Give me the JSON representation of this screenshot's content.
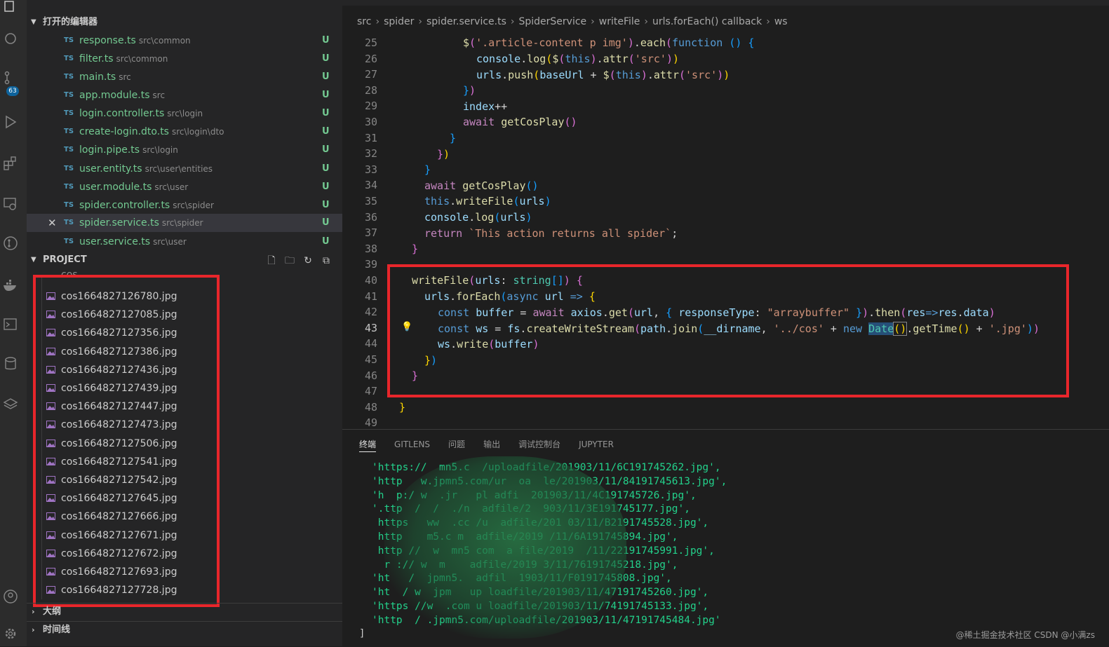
{
  "activity_bar": {
    "badge": "63"
  },
  "sidebar": {
    "open_editors_title": "打开的编辑器",
    "open_editors": [
      {
        "name": "response.ts",
        "dir": "src\\common",
        "status": "U"
      },
      {
        "name": "filter.ts",
        "dir": "src\\common",
        "status": "U"
      },
      {
        "name": "main.ts",
        "dir": "src",
        "status": "U"
      },
      {
        "name": "app.module.ts",
        "dir": "src",
        "status": "U"
      },
      {
        "name": "login.controller.ts",
        "dir": "src\\login",
        "status": "U"
      },
      {
        "name": "create-login.dto.ts",
        "dir": "src\\login\\dto",
        "status": "U"
      },
      {
        "name": "login.pipe.ts",
        "dir": "src\\login",
        "status": "U"
      },
      {
        "name": "user.entity.ts",
        "dir": "src\\user\\entities",
        "status": "U"
      },
      {
        "name": "user.module.ts",
        "dir": "src\\user",
        "status": "U"
      },
      {
        "name": "spider.controller.ts",
        "dir": "src\\spider",
        "status": "U"
      },
      {
        "name": "spider.service.ts",
        "dir": "src\\spider",
        "status": "U"
      },
      {
        "name": "user.service.ts",
        "dir": "src\\user",
        "status": "U"
      }
    ],
    "ts_label": "TS",
    "close_glyph": "✕",
    "project_title": "PROJECT",
    "cos_folder": "cos",
    "files": [
      "cos1664827126780.jpg",
      "cos1664827127085.jpg",
      "cos1664827127356.jpg",
      "cos1664827127386.jpg",
      "cos1664827127436.jpg",
      "cos1664827127439.jpg",
      "cos1664827127447.jpg",
      "cos1664827127473.jpg",
      "cos1664827127506.jpg",
      "cos1664827127541.jpg",
      "cos1664827127542.jpg",
      "cos1664827127645.jpg",
      "cos1664827127666.jpg",
      "cos1664827127671.jpg",
      "cos1664827127672.jpg",
      "cos1664827127693.jpg",
      "cos1664827127728.jpg"
    ],
    "outline_title": "大纲",
    "timeline_title": "时间线"
  },
  "breadcrumb": [
    "src",
    "spider",
    "spider.service.ts",
    "SpiderService",
    "writeFile",
    "urls.forEach() callback",
    "ws"
  ],
  "editor": {
    "line_numbers": [
      "25",
      "26",
      "27",
      "28",
      "29",
      "30",
      "31",
      "32",
      "33",
      "34",
      "35",
      "36",
      "37",
      "38",
      "39",
      "40",
      "41",
      "42",
      "43",
      "44",
      "45",
      "46",
      "47",
      "48",
      "49"
    ],
    "current_line": "43"
  },
  "panel": {
    "tabs": [
      "终端",
      "GITLENS",
      "问题",
      "输出",
      "调试控制台",
      "JUPYTER"
    ],
    "terminal_lines": [
      "'https://  mn5.c  /uploadfile/201903/11/6C191745262.jpg',",
      "'http   w.jpmn5.com/ur  oa  le/201903/11/84191745613.jpg',",
      "'h  p:/ w  .jr   pl adfi  201903/11/4C191745726.jpg',",
      "'.ttp  /  /  ./n  adfile/2  903/11/3E191745177.jpg',",
      " https   ww  .cc /u  adfile/201 03/11/B2191745528.jpg',",
      " http    m5.c m  adfile/2019 /11/6A191745894.jpg',",
      " http //  w  mn5 com  a file/2019  /11/22191745991.jpg',",
      "  r :// w  m    adfile/2019 3/11/76191745218.jpg',",
      "'ht   /  jpmn5.  adfil  1903/11/F0191745808.jpg',",
      "'ht  / w  jpm   up loadfile/201903/11/47191745260.jpg',",
      "'https //w  .com u loadfile/201903/11/74191745133.jpg',",
      "'http  / .jpmn5.com/uploadfile/201903/11/47191745484.jpg'"
    ],
    "terminal_end": "]"
  },
  "watermark": "@稀土掘金技术社区  CSDN @小满zs"
}
